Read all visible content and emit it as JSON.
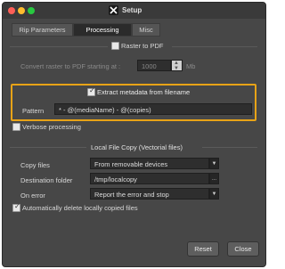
{
  "window": {
    "title": "Setup"
  },
  "tabs": [
    {
      "label": "Rip Parameters"
    },
    {
      "label": "Processing"
    },
    {
      "label": "Misc"
    }
  ],
  "raster": {
    "checkbox_label": "Raster to PDF",
    "checked": false,
    "convert_label": "Convert raster to PDF starting at :",
    "convert_value": "1000",
    "unit": "Mb"
  },
  "metadata": {
    "checkbox_label": "Extract metadata from filename",
    "checked": true,
    "pattern_label": "Pattern",
    "pattern_value": "* - @(mediaName) - @(copies)"
  },
  "verbose": {
    "label": "Verbose processing",
    "checked": false
  },
  "local_copy": {
    "heading": "Local File Copy (Vectorial files)",
    "copy_files_label": "Copy files",
    "copy_files_value": "From removable devices",
    "destination_label": "Destination folder",
    "destination_value": "/tmp/localcopy",
    "browse_label": "...",
    "on_error_label": "On error",
    "on_error_value": "Report the error and stop",
    "auto_delete_label": "Automatically delete locally copied files",
    "auto_delete_checked": true
  },
  "buttons": {
    "reset": "Reset",
    "close": "Close"
  },
  "colors": {
    "highlight": "#e8a317",
    "window_bg": "#474747"
  }
}
